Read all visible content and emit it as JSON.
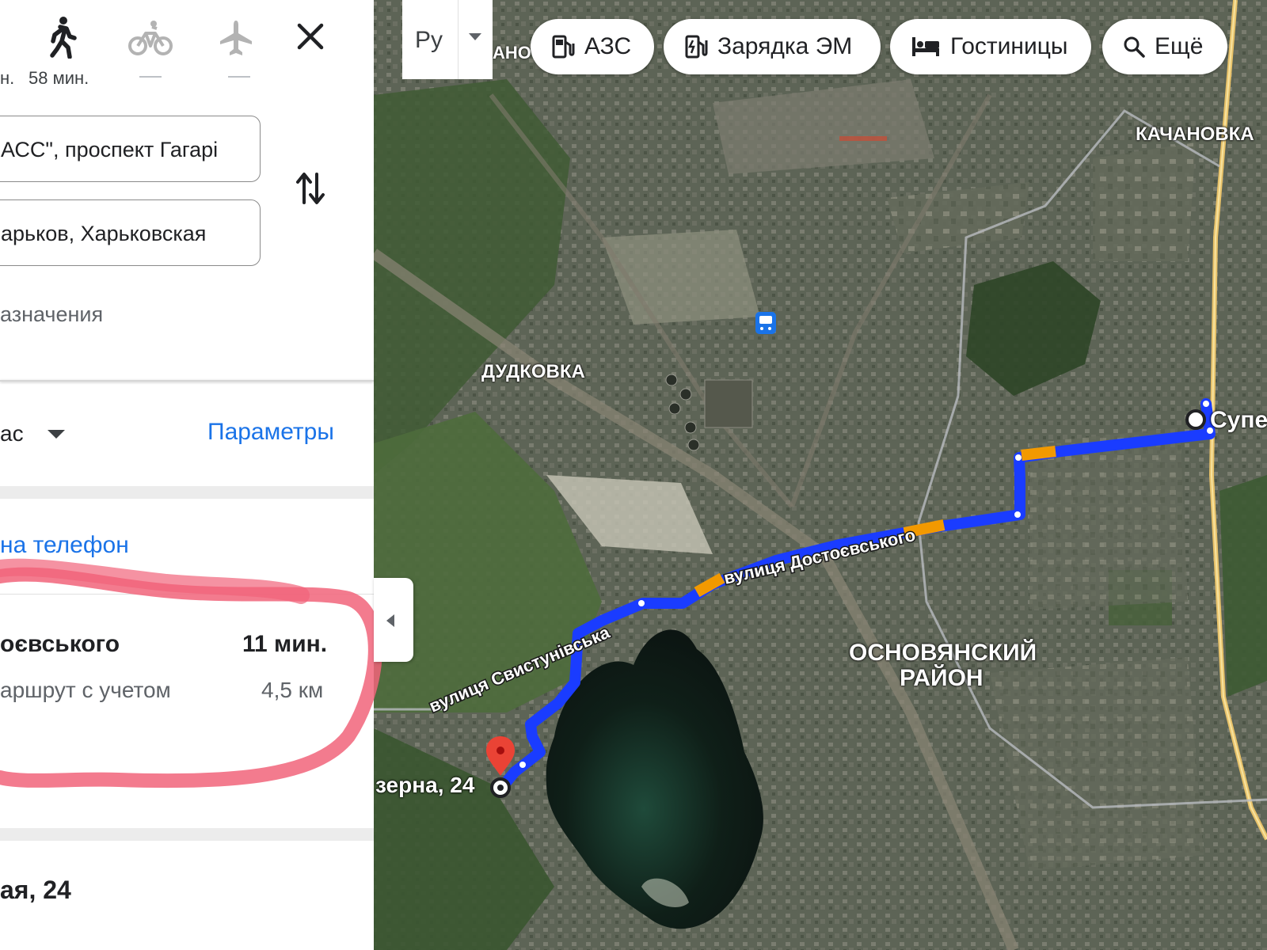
{
  "modes": [
    {
      "name": "drive",
      "time": "н."
    },
    {
      "name": "walk",
      "time": "58 мин."
    },
    {
      "name": "bike",
      "time": ""
    },
    {
      "name": "flight",
      "time": ""
    }
  ],
  "route_form": {
    "origin_value": "АСС\", проспект Гагарі",
    "destination_value": "арьков, Харьковская",
    "add_destination": "азначения"
  },
  "options": {
    "depart_label": "ас",
    "params_label": "Параметры"
  },
  "send_to_phone": "на телефон",
  "route": {
    "via": "оєвського",
    "duration": "11 мин.",
    "note": "аршрут с учетом",
    "distance": "4,5 км"
  },
  "destination_footer": "ая, 24",
  "map": {
    "language": "Ру",
    "chips": [
      "АЗС",
      "Зарядка ЭМ",
      "Гостиницы",
      "Ещё"
    ],
    "partial_top_label": "АНО",
    "labels": {
      "kachanovka": "КАЧАНОВКА",
      "dudkovka": "ДУДКОВКА",
      "osnovyansky_1": "ОСНОВЯНСКИЙ",
      "osnovyansky_2": "РАЙОН",
      "street_dostoevskogo": "вулиця Достоєвського",
      "street_svystunivska": "вулиця Свистунівська",
      "origin_label": "Супе",
      "destination_label": "зерна, 24"
    },
    "colors": {
      "route": "#1a3cff",
      "route_slow": "#f29900",
      "marker": "#ea4335",
      "link": "#1a73e8"
    }
  }
}
